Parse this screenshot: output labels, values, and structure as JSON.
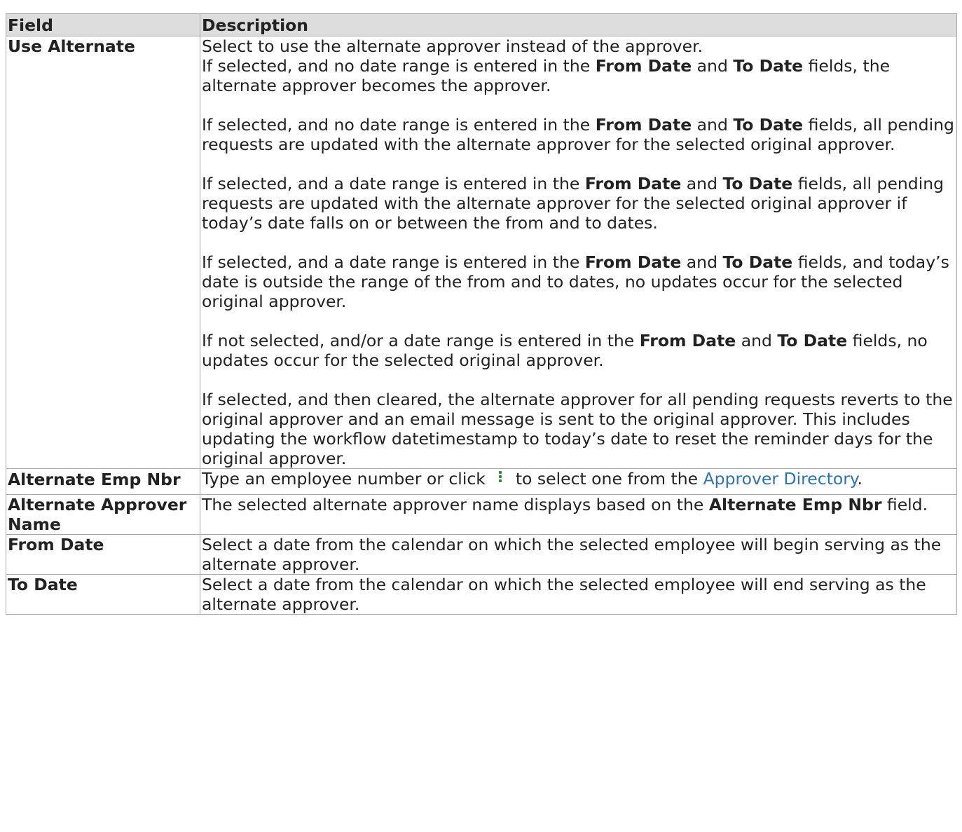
{
  "table": {
    "headers": {
      "field": "Field",
      "description": "Description"
    },
    "rows": {
      "use_alternate": {
        "field": "Use Alternate",
        "p1": {
          "line1": "Select to use the alternate approver instead of the approver.",
          "pre": "If selected, and no date range is entered in the ",
          "b1": "From Date",
          "mid": " and ",
          "b2": "To Date",
          "post": " fields, the alternate approver becomes the approver."
        },
        "p2": {
          "pre": "If selected, and no date range is entered in the ",
          "b1": "From Date",
          "mid": " and ",
          "b2": "To Date",
          "post": " fields, all pending requests are updated with the alternate approver for the selected original approver."
        },
        "p3": {
          "pre": "If selected, and a date range is entered in the ",
          "b1": "From Date",
          "mid": " and ",
          "b2": "To Date",
          "post": " fields, all pending requests are updated with the alternate approver for the selected original approver if today’s date falls on or between the from and to dates."
        },
        "p4": {
          "pre": "If selected, and a date range is entered in the ",
          "b1": "From Date",
          "mid": " and ",
          "b2": "To Date",
          "post": " fields, and today’s date is outside the range of the from and to dates, no updates occur for the selected original approver."
        },
        "p5": {
          "pre": "If not selected, and/or a date range is entered in the ",
          "b1": "From Date",
          "mid": " and ",
          "b2": "To Date",
          "post": " fields, no updates occur for the selected original approver."
        },
        "p6": "If selected, and then cleared, the alternate approver for all pending requests reverts to the original approver and an email message is sent to the original approver. This includes updating the workflow datetimestamp to today’s date to reset the reminder days for the original approver."
      },
      "alternate_emp_nbr": {
        "field": "Alternate Emp Nbr",
        "pre": "Type an employee number or click ",
        "icon": "vertical-dots-icon",
        "mid": " to select one from the ",
        "link": "Approver Directory",
        "post": "."
      },
      "alternate_approver_name": {
        "field": "Alternate Approver Name",
        "pre": "The selected alternate approver name displays based on the ",
        "b1": "Alternate Emp Nbr",
        "post": " field."
      },
      "from_date": {
        "field": "From Date",
        "desc": "Select a date from the calendar on which the selected employee will begin serving as the alternate approver."
      },
      "to_date": {
        "field": "To Date",
        "desc": "Select a date from the calendar on which the selected employee will end serving as the alternate approver."
      }
    }
  },
  "colors": {
    "header_bg": "#dddddd",
    "border": "#aaaaaa",
    "link": "#2b73b7",
    "icon": "#2e8b3a",
    "text": "#222222"
  }
}
